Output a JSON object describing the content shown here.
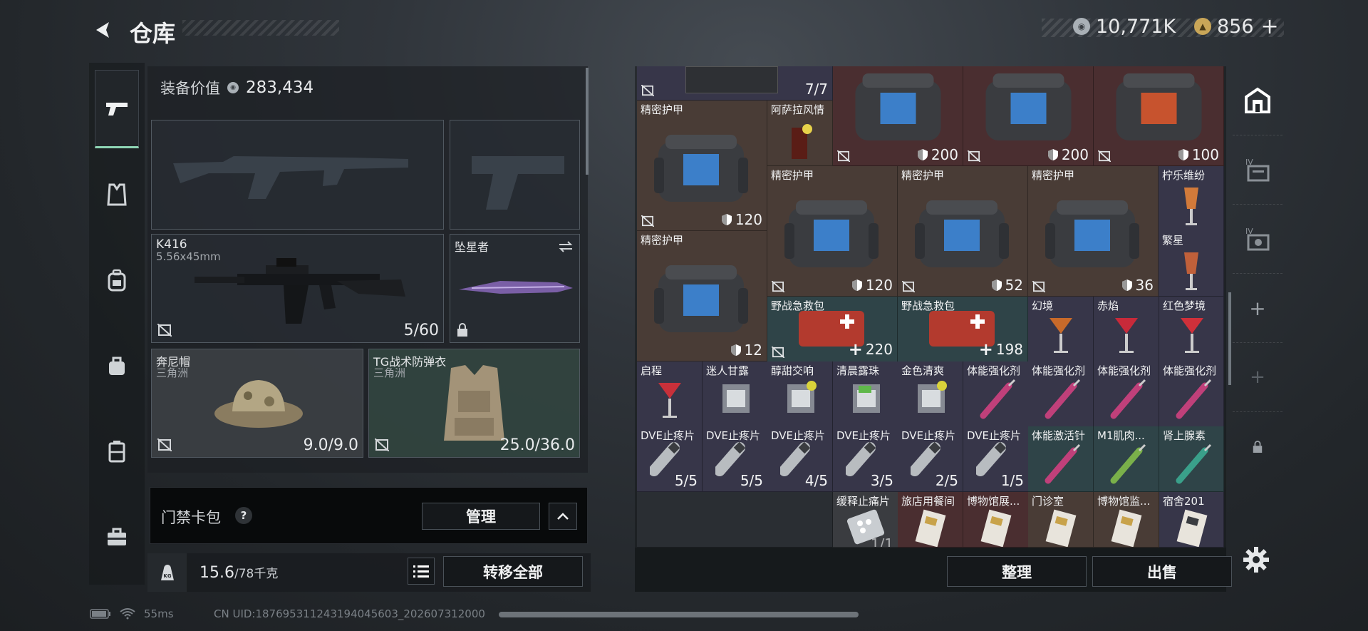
{
  "header": {
    "title": "仓库",
    "currency": [
      {
        "icon": "silver-coin-icon",
        "value": "10,771K"
      },
      {
        "icon": "gold-coin-icon",
        "value": "856"
      }
    ],
    "add_label": "+"
  },
  "sidebar": {
    "items": [
      {
        "icon": "pistol-icon",
        "active": true
      },
      {
        "icon": "vest-icon"
      },
      {
        "icon": "backpack-icon"
      },
      {
        "icon": "pouch-icon"
      },
      {
        "icon": "case-icon"
      },
      {
        "icon": "toolbox-icon"
      }
    ]
  },
  "loadout": {
    "equip_value_label": "装备价值",
    "equip_value": "283,434",
    "slots": {
      "primary_empty": {
        "icon": "rifle-silhouette-icon"
      },
      "secondary_empty": {
        "icon": "pistol-silhouette-icon"
      },
      "weapon": {
        "name": "K416",
        "sub": "5.56x45mm",
        "value": "5/60"
      },
      "melee": {
        "name": "坠星者",
        "swap_icon": "swap-icon",
        "locked": true
      },
      "helmet": {
        "name": "奔尼帽",
        "sub": "三角洲",
        "value": "9.0/9.0"
      },
      "armor": {
        "name": "TG战术防弹衣",
        "sub": "三角洲",
        "value": "25.0/36.0"
      }
    }
  },
  "keycard": {
    "label": "门禁卡包",
    "help": "?",
    "manage_label": "管理"
  },
  "weight": {
    "icon": "kg-weight-icon",
    "current": "15.6",
    "max": "/78千克",
    "transfer_label": "转移全部"
  },
  "status_bar": {
    "ping": "55ms",
    "uid": "CN UID:187695311243194045603_202607312000"
  },
  "stash": {
    "items": [
      {
        "name": "",
        "value": "7/7"
      },
      {
        "name": "精密护甲",
        "value": "120"
      },
      {
        "name": "阿萨拉风情",
        "value": ""
      },
      {
        "name": "",
        "value": "200"
      },
      {
        "name": "",
        "value": "200"
      },
      {
        "name": "",
        "value": "100"
      },
      {
        "name": "精密护甲",
        "value": "120"
      },
      {
        "name": "精密护甲",
        "value": "52"
      },
      {
        "name": "精密护甲",
        "value": "36"
      },
      {
        "name": "柠乐维纷",
        "value": ""
      },
      {
        "name": "精密护甲",
        "value": "12"
      },
      {
        "name": "繁星",
        "value": ""
      },
      {
        "name": "野战急救包",
        "value": "220"
      },
      {
        "name": "野战急救包",
        "value": "198"
      },
      {
        "name": "幻境",
        "value": ""
      },
      {
        "name": "赤焰",
        "value": ""
      },
      {
        "name": "红色梦境",
        "value": ""
      },
      {
        "name": "启程",
        "value": ""
      },
      {
        "name": "迷人甘露",
        "value": ""
      },
      {
        "name": "醇甜交响",
        "value": ""
      },
      {
        "name": "清晨露珠",
        "value": ""
      },
      {
        "name": "金色清爽",
        "value": ""
      },
      {
        "name": "体能强化剂",
        "value": ""
      },
      {
        "name": "体能强化剂",
        "value": ""
      },
      {
        "name": "体能强化剂",
        "value": ""
      },
      {
        "name": "体能强化剂",
        "value": ""
      },
      {
        "name": "DVE止疼片",
        "value": "5/5"
      },
      {
        "name": "DVE止疼片",
        "value": "5/5"
      },
      {
        "name": "DVE止疼片",
        "value": "4/5"
      },
      {
        "name": "DVE止疼片",
        "value": "3/5"
      },
      {
        "name": "DVE止疼片",
        "value": "2/5"
      },
      {
        "name": "DVE止疼片",
        "value": "1/5"
      },
      {
        "name": "体能激活针",
        "value": ""
      },
      {
        "name": "M1肌肉...",
        "value": ""
      },
      {
        "name": "肾上腺素",
        "value": ""
      },
      {
        "name": "缓释止痛片",
        "value": "1/1"
      },
      {
        "name": "旅店用餐间",
        "value": ""
      },
      {
        "name": "博物馆展...",
        "value": ""
      },
      {
        "name": "门诊室",
        "value": ""
      },
      {
        "name": "博物馆监...",
        "value": ""
      },
      {
        "name": "宿舍201",
        "value": ""
      }
    ],
    "sort_label": "整理",
    "sell_label": "出售"
  },
  "right_sidebar": {
    "items": [
      {
        "icon": "stash-home-icon"
      },
      {
        "icon": "expansion-iv-icon"
      },
      {
        "icon": "expansion-iv-camera-icon"
      },
      {
        "icon": "add-icon"
      },
      {
        "icon": "add-icon-dim"
      },
      {
        "icon": "lock-icon"
      }
    ],
    "settings_icon": "gear-icon"
  },
  "colors": {
    "accent": "#8fd6b5",
    "cell_red": "#4a2e30",
    "cell_brown": "#493c36",
    "cell_teal": "#2f4448",
    "cell_purple": "#373649"
  }
}
